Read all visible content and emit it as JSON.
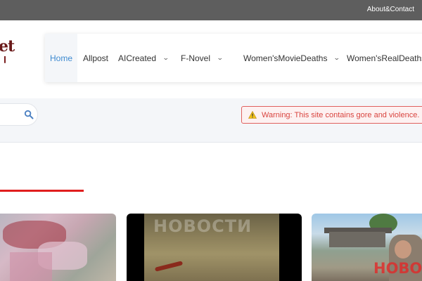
{
  "topbar": {
    "link_label": "About&Contact"
  },
  "logo": {
    "text": "et"
  },
  "nav": {
    "items": [
      {
        "label": "Home",
        "active": true,
        "has_dropdown": false
      },
      {
        "label": "Allpost",
        "active": false,
        "has_dropdown": false
      },
      {
        "label": "AICreated",
        "active": false,
        "has_dropdown": true
      },
      {
        "label": "F-Novel",
        "active": false,
        "has_dropdown": true
      },
      {
        "label": "Women'sMovieDeaths",
        "active": false,
        "has_dropdown": true
      },
      {
        "label": "Women'sRealDeaths",
        "active": false,
        "has_dropdown": false
      }
    ],
    "dropdown_icon": "chevron-down-icon"
  },
  "search": {
    "value": "",
    "placeholder": "",
    "icon": "search-icon"
  },
  "warning": {
    "icon": "warning-icon",
    "text": "Warning: This site contains gore and violence. Ple"
  },
  "thumbnails": {
    "card2_watermark": "НОВОСТИ",
    "card3_watermark": "НОВОС"
  },
  "colors": {
    "topbar": "#5e5e5e",
    "nav_active": "#3d8ad0",
    "warning": "#d9443f",
    "section_underline": "#e01e1e",
    "logo": "#6a1a1a"
  }
}
